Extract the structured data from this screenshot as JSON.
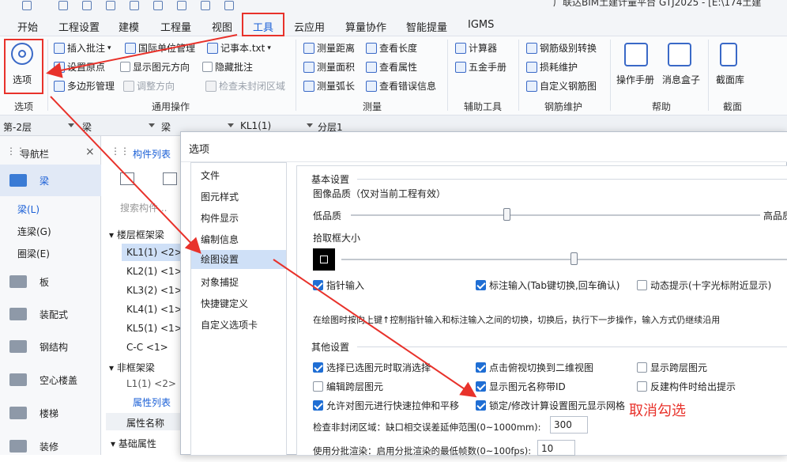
{
  "window": {
    "title": "广联达BIM土建计量平台 GTJ2025 - [E:\\174土建"
  },
  "menubar": {
    "items": [
      "开始",
      "工程设置",
      "建模",
      "工程量",
      "视图",
      "工具",
      "云应用",
      "算量协作",
      "智能提量",
      "IGMS"
    ],
    "active": "工具"
  },
  "ribbon": {
    "options_label": "选项",
    "options_group": "选项",
    "common_ops": {
      "group": "通用操作",
      "insert_note": "插入批注",
      "intl_units": "国际单位管理",
      "notepad": "记事本.txt",
      "set_origin": "设置原点",
      "show_direction": "显示图元方向",
      "hide_note": "隐藏批注",
      "polygon_mgmt": "多边形管理",
      "adjust_direction": "调整方向",
      "check_unclosed": "检查未封闭区域"
    },
    "measure": {
      "group": "测量",
      "distance": "测量距离",
      "area": "测量面积",
      "arc": "测量弧长",
      "length": "查看长度",
      "attributes": "查看属性",
      "errors": "查看错误信息"
    },
    "aux_tools": {
      "group": "辅助工具",
      "calculator": "计算器",
      "hardware_manual": "五金手册"
    },
    "rebar_maint": {
      "group": "钢筋维护",
      "grade_convert": "钢筋级别转换",
      "loss": "损耗维护",
      "custom": "自定义钢筋图"
    },
    "help": {
      "group": "帮助",
      "manual": "操作手册",
      "msg_box": "消息盒子"
    },
    "section": {
      "group": "截面",
      "lib": "截面库"
    }
  },
  "selectorbar": {
    "floor": "第-2层",
    "type": "梁",
    "subtype": "梁",
    "component": "KL1(1)",
    "layer": "分层1"
  },
  "nav": {
    "title": "导航栏",
    "beam": "梁",
    "sub": [
      "梁(L)",
      "连梁(G)",
      "圈梁(E)"
    ],
    "items": [
      "板",
      "装配式",
      "钢结构",
      "空心楼盖",
      "楼梯",
      "装修"
    ]
  },
  "complist": {
    "tab": "构件列表",
    "search_placeholder": "搜索构件...",
    "group1": "楼层框架梁",
    "items": [
      "KL1(1) <2>",
      "KL2(1) <1>",
      "KL3(2) <1>",
      "KL4(1) <1>",
      "KL5(1) <1>",
      "C-C <1>"
    ],
    "group2": "非框架梁",
    "partial": "L1(1) <2>"
  },
  "props": {
    "tab": "属性列表",
    "col": "属性名称",
    "row": "基础属性"
  },
  "dialog": {
    "title": "选项",
    "left": [
      "文件",
      "图元样式",
      "构件显示",
      "编制信息",
      "绘图设置",
      "对象捕捉",
      "快捷键定义",
      "自定义选项卡"
    ],
    "selected": "绘图设置",
    "basic": {
      "header": "基本设置",
      "quality_label": "图像品质（仅对当前工程有效）",
      "low": "低品质",
      "high": "高品质",
      "quality": 0.38,
      "pick_label": "拾取框大小",
      "pick": 0.52,
      "cb_pointer": "指针输入",
      "cb_dim": "标注输入(Tab键切换,回车确认)",
      "cb_dynamic": "动态提示(十字光标附近显示)",
      "hint": "在绘图时按向上键↑控制指针输入和标注输入之间的切换，切换后，执行下一步操作，输入方式仍继续沿用"
    },
    "other": {
      "header": "其他设置",
      "c1": "选择已选图元时取消选择",
      "c2": "点击俯视切换到二维视图",
      "c3": "显示跨层图元",
      "c4": "编辑跨层图元",
      "c5": "显示图元名称带ID",
      "c6": "反建构件时给出提示",
      "c7": "允许对图元进行快速拉伸和平移",
      "c8": "锁定/修改计算设置图元显示网格",
      "unclosed_label": "检查非封闭区域：缺口相交误差延伸范围(0~1000mm):",
      "unclosed_value": "300",
      "batch_label": "使用分批渲染：启用分批渲染的最低帧数(0~100fps):",
      "batch_value": "10"
    }
  },
  "annotation": {
    "note": "取消勾选",
    "color": "#e8322b"
  },
  "colors": {
    "accent": "#1f6ed4",
    "red": "#e8322b"
  }
}
